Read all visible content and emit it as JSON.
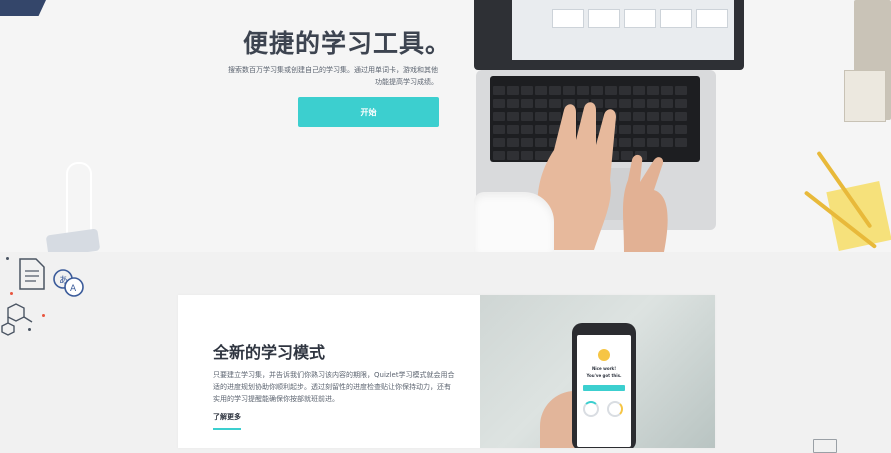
{
  "hero": {
    "title": "便捷的学习工具。",
    "subtitle": "搜索数百万学习集或创建自己的学习集。通过用单词卡，游戏和其他功能提高学习成绩。",
    "start_label": "开始"
  },
  "feature": {
    "title": "全新的学习模式",
    "description": "只要建立学习集，并告诉我们你熟习该内容的期限，Quizlet学习模式就会用合适的进度规划协助你顺利起步。透过刻留性的进度检查贴让你保持动力，还有实用的学习提醒能确保你按部就班前进。",
    "learn_more_label": "了解更多"
  },
  "phone_screen": {
    "line1": "Nice work!",
    "line2": "You've got this."
  },
  "colors": {
    "accent": "#3ccfcf",
    "title_text": "#3d4450",
    "body_text": "#5c6470"
  },
  "icons": [
    "document-icon",
    "translate-icon",
    "molecule-icon",
    "chart-icon"
  ]
}
